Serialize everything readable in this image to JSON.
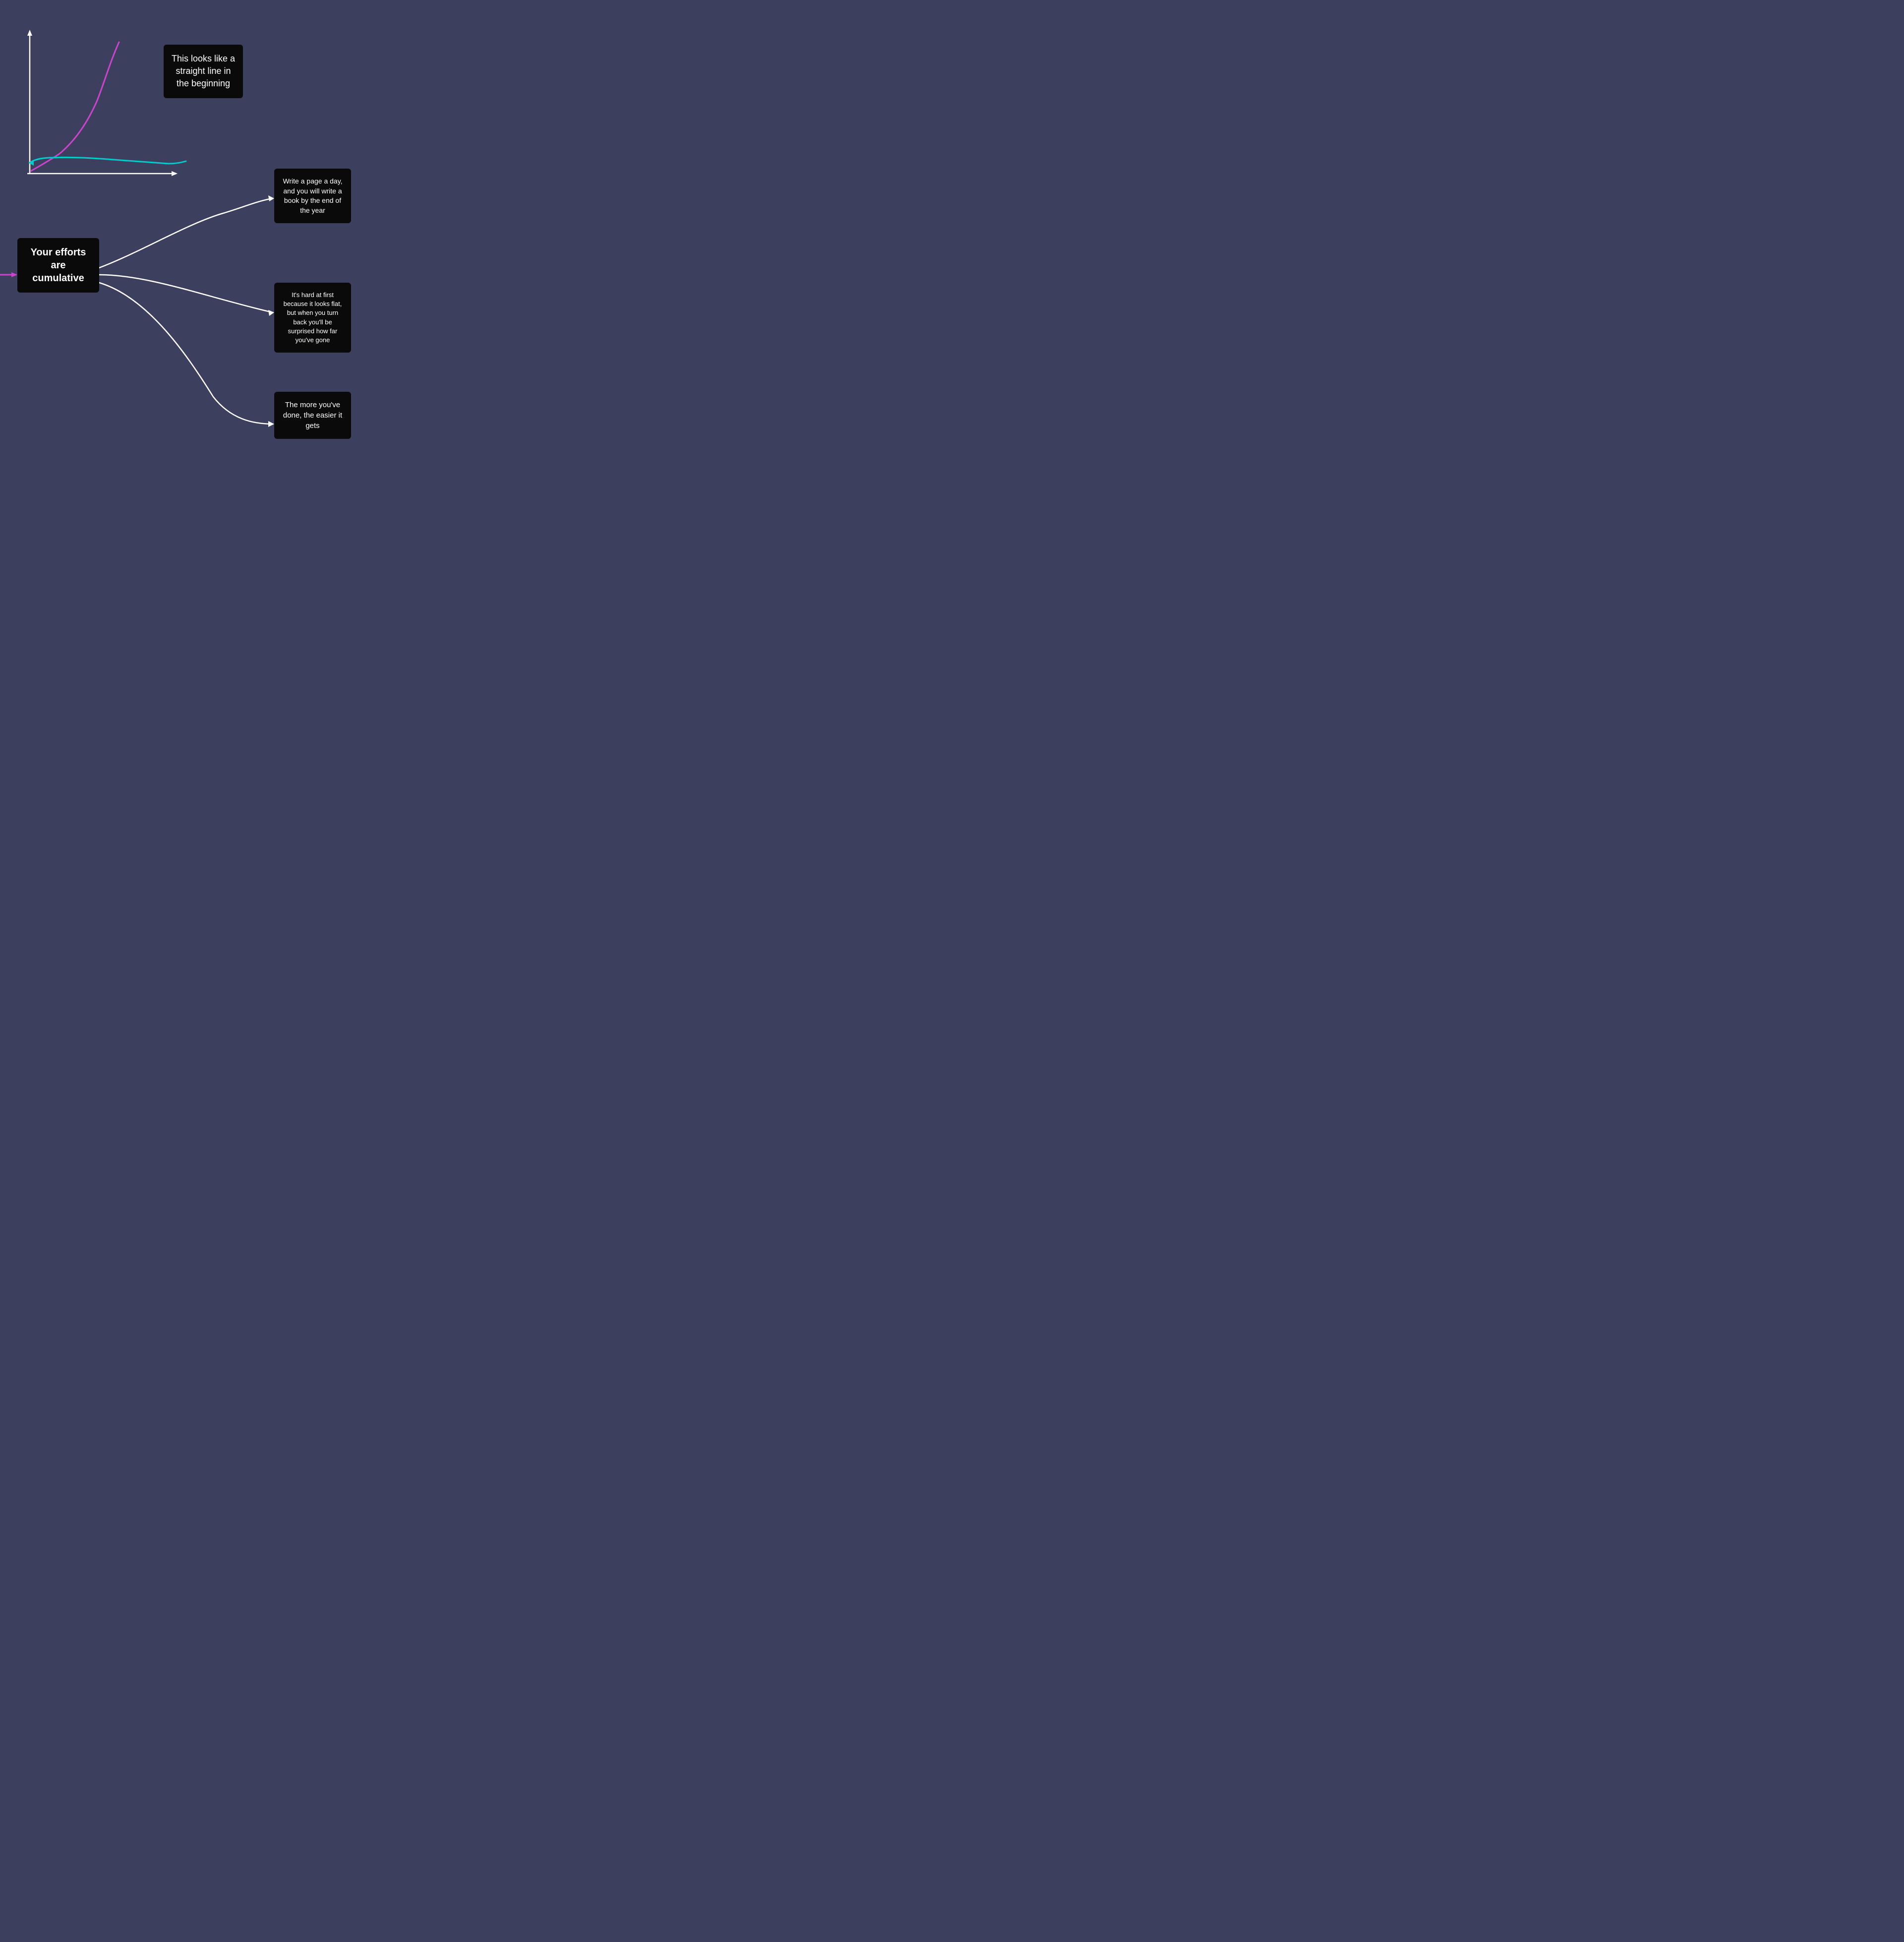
{
  "background_color": "#3d3f5e",
  "cards": {
    "straight_line": {
      "text": "This looks like a straight line in the beginning"
    },
    "efforts": {
      "text": "Your efforts are cumulative"
    },
    "page_a_day": {
      "text": "Write a page a day, and you will write a book by the end of the year"
    },
    "hard_at_first": {
      "text": "It's hard at first because it looks flat, but when you turn back you'll be surprised how far you've gone"
    },
    "more_youve_done": {
      "text": "The more you've done, the easier it gets"
    }
  },
  "arrows": {
    "incoming_purple": "magenta arrow from left pointing to efforts card",
    "exponential_curve": "purple/magenta exponential curve on chart",
    "flat_curve_arrow": "teal/cyan arrow pointing left on chart baseline"
  }
}
